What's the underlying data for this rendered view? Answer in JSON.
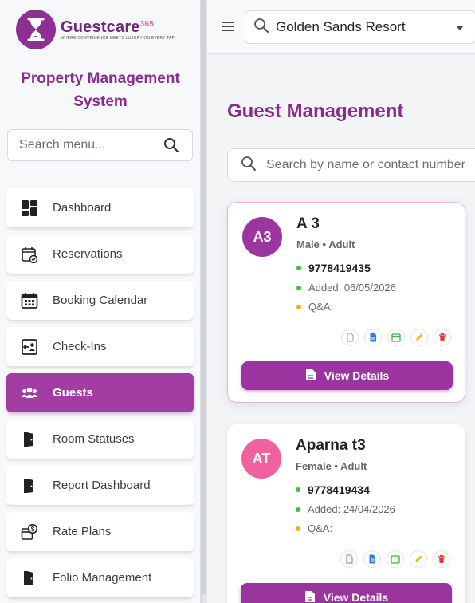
{
  "brand": {
    "name": "Guestcare",
    "suffix": "365",
    "tagline": "WHERE CONVENIENCE MEETS LUXURY ON EVERY TAP!"
  },
  "app_title_line1": "Property Management",
  "app_title_line2": "System",
  "menu_search": {
    "placeholder": "Search menu..."
  },
  "nav": [
    {
      "label": "Dashboard",
      "icon": "dashboard-grid-icon"
    },
    {
      "label": "Reservations",
      "icon": "calendar-check-icon"
    },
    {
      "label": "Booking Calendar",
      "icon": "calendar-grid-icon"
    },
    {
      "label": "Check-Ins",
      "icon": "check-in-icon"
    },
    {
      "label": "Guests",
      "icon": "users-icon",
      "active": true
    },
    {
      "label": "Room Statuses",
      "icon": "door-icon"
    },
    {
      "label": "Report Dashboard",
      "icon": "door-icon"
    },
    {
      "label": "Rate Plans",
      "icon": "rate-plan-icon"
    },
    {
      "label": "Folio Management",
      "icon": "door-icon"
    }
  ],
  "topbar": {
    "property": "Golden Sands Resort"
  },
  "page": {
    "title": "Guest Management",
    "search_placeholder": "Search by name or contact number"
  },
  "guests": [
    {
      "initials": "A3",
      "name": "A 3",
      "meta": "Male • Adult",
      "phone": "9778419435",
      "added": "Added: 06/05/2026",
      "qa": "Q&A:",
      "avatar_color": "#9b359f",
      "button": "View Details"
    },
    {
      "initials": "AT",
      "name": "Aparna t3",
      "meta": "Female • Adult",
      "phone": "9778419434",
      "added": "Added: 24/04/2026",
      "qa": "Q&A:",
      "avatar_color": "#f0619e",
      "button": "View Details"
    }
  ],
  "colors": {
    "accent": "#9a35a0",
    "title": "#8a2b8f",
    "green_dot": "#3cc13b",
    "yellow_dot": "#f5b400"
  }
}
